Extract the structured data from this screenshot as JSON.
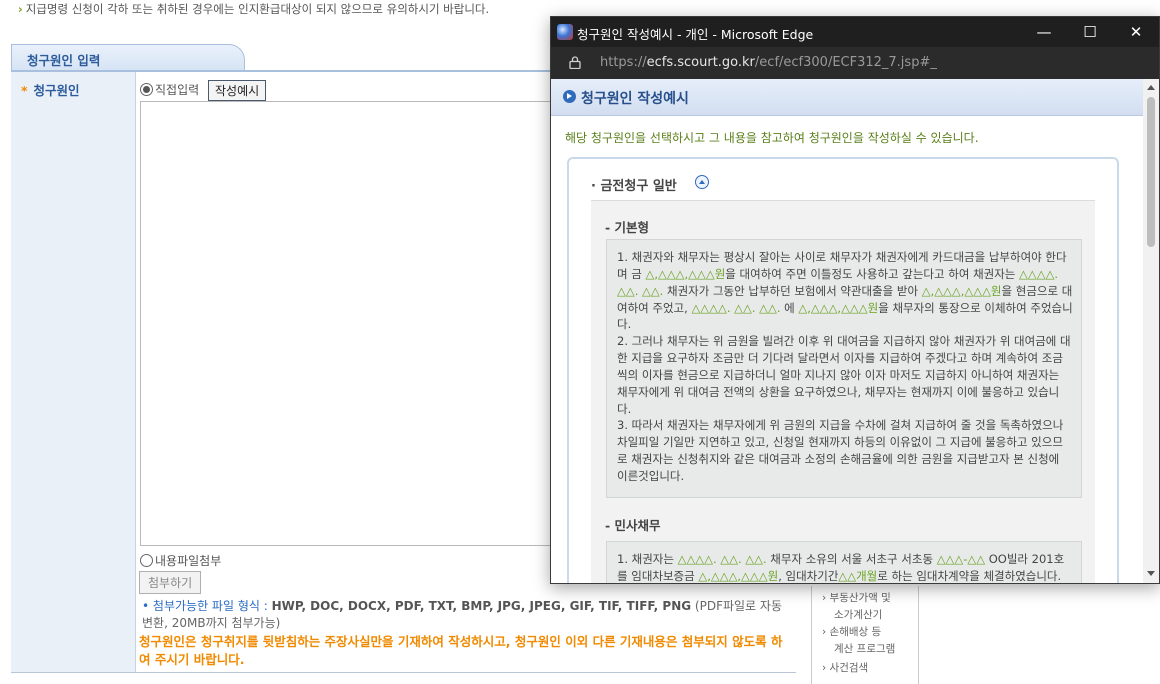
{
  "background": {
    "notice": "지급명령 신청이 각하 또는 취하된 경우에는 인지환급대상이 되지 않으므로 유의하시기 바랍니다.",
    "tab_label": "청구원인 입력",
    "field_label": "청구원인",
    "radio_direct": "직접입력",
    "example_button": "작성예시",
    "radio_file": "내용파일첨부",
    "attach_button": "첨부하기",
    "filetypes_label": "첨부가능한 파일 형식 : ",
    "filetypes_list": "HWP, DOC, DOCX, PDF, TXT, BMP, JPG, JPEG, GIF, TIF, TIFF, PNG",
    "filetypes_note": " (PDF파일로 자동변환, 20MB까지 첨부가능)",
    "warning": "청구원인은 청구취지를 뒷받침하는 주장사실만을 기재하여 작성하시고, 청구원인 이외 다른 기재내용은 첨부되지 않도록 하여 주시기 바랍니다.",
    "side_links": [
      "부동산가액 및",
      "소가계산기",
      "손해배상 등",
      "계산 프로그램",
      "사건검색"
    ]
  },
  "popup": {
    "window_title": "청구원인 작성예시 - 개인 - Microsoft Edge",
    "url_prefix": "https://",
    "url_host": "ecfs.scourt.go.kr",
    "url_path": "/ecf/ecf300/ECF312_7.jsp#_",
    "header": "청구원인 작성예시",
    "instruction": "해당 청구원인을 선택하시고 그 내용을 참고하여 청구원인을 작성하실 수 있습니다.",
    "section_title": "· 금전청구 일반",
    "sub1_title": "- 기본형",
    "sub2_title": "- 민사채무",
    "example1": [
      {
        "t": "1. 채권자와 채무자는 평상시 잘아는 사이로 채무자가 채권자에게 카드대금을 납부하여야 한다며 금 "
      },
      {
        "t": "△,△△△,△△△원",
        "g": true
      },
      {
        "t": "을 대여하여 주면 이틀정도 사용하고 갚는다고 하여 채권자는 "
      },
      {
        "t": "△△△△. △△. △△.",
        "g": true
      },
      {
        "t": " 채권자가 그동안 납부하던 보험에서 약관대출을 받아 "
      },
      {
        "t": "△,△△△,△△△원",
        "g": true
      },
      {
        "t": "을 현금으로 대여하여 주었고, "
      },
      {
        "t": "△△△△. △△. △△.",
        "g": true
      },
      {
        "t": " 에 "
      },
      {
        "t": "△,△△△,△△△원",
        "g": true
      },
      {
        "t": "을 채무자의 통장으로 이체하여 주었습니다.\n2. 그러나 채무자는 위 금원을 빌려간 이후 위 대여금을 지급하지 않아 채권자가 위 대여금에 대한 지급을 요구하자 조금만 더 기다려 달라면서 이자를 지급하여 주겠다고 하며 계속하여 조금씩의 이자를 현금으로 지급하더니 얼마 지나지 않아 이자 마저도 지급하지 아니하여 채권자는 채무자에게 위 대여금 전액의 상환을 요구하였으나, 채무자는 현재까지 이에 불응하고 있습니다.\n3. 따라서 채권자는 채무자에게 위 금원의 지급을 수차에 걸쳐 지급하여 줄 것을 독촉하였으나 차일피일 기일만 지연하고 있고, 신청일 현재까지 하등의 이유없이 그 지급에 불응하고 있으므로 채권자는 신청취지와 같은 대여금과 소정의 손해금율에 의한 금원을 지급받고자 본 신청에 이른것입니다."
      }
    ],
    "example2": [
      {
        "t": "1. 채권자는 "
      },
      {
        "t": "△△△△. △△. △△.",
        "g": true
      },
      {
        "t": " 채무자 소유의 서울 서초구 서초동 "
      },
      {
        "t": "△△△-△△",
        "g": true
      },
      {
        "t": " OO빌라 201호를 임대차보증금 "
      },
      {
        "t": "△,△△△,△△△원",
        "g": true
      },
      {
        "t": ", 임대차기간"
      },
      {
        "t": "△△개월",
        "g": true
      },
      {
        "t": "로 하는 임대차계약을 체결하였습니다."
      }
    ]
  }
}
